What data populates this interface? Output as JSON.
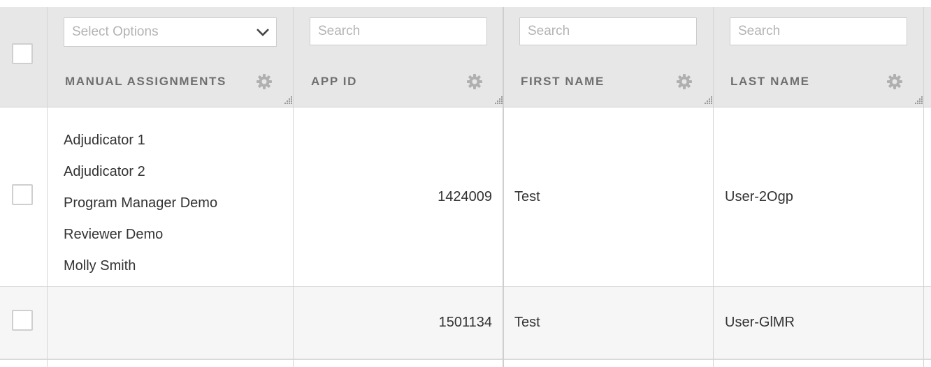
{
  "header": {
    "columns": [
      {
        "key": "manual_assignments",
        "title": "MANUAL ASSIGNMENTS",
        "filter_type": "select",
        "filter_placeholder": "Select Options"
      },
      {
        "key": "app_id",
        "title": "APP ID",
        "filter_type": "search",
        "filter_placeholder": "Search"
      },
      {
        "key": "first_name",
        "title": "FIRST NAME",
        "filter_type": "search",
        "filter_placeholder": "Search"
      },
      {
        "key": "last_name",
        "title": "LAST NAME",
        "filter_type": "search",
        "filter_placeholder": "Search"
      }
    ]
  },
  "rows": [
    {
      "manual_assignments": [
        "Adjudicator 1",
        "Adjudicator 2",
        "Program Manager Demo",
        "Reviewer Demo",
        "Molly Smith"
      ],
      "app_id": "1424009",
      "first_name": "Test",
      "last_name": "User-2Ogp"
    },
    {
      "manual_assignments": [],
      "app_id": "1501134",
      "first_name": "Test",
      "last_name": "User-GlMR"
    }
  ],
  "icons": {
    "gear": "gear-icon",
    "chevron": "chevron-down-icon",
    "resize": "resize-handle-icon"
  },
  "colors": {
    "header_bg": "#e7e7e7",
    "alt_row_bg": "#f6f6f6",
    "title_text": "#6f6f6f",
    "icon": "#b0b0b0"
  }
}
